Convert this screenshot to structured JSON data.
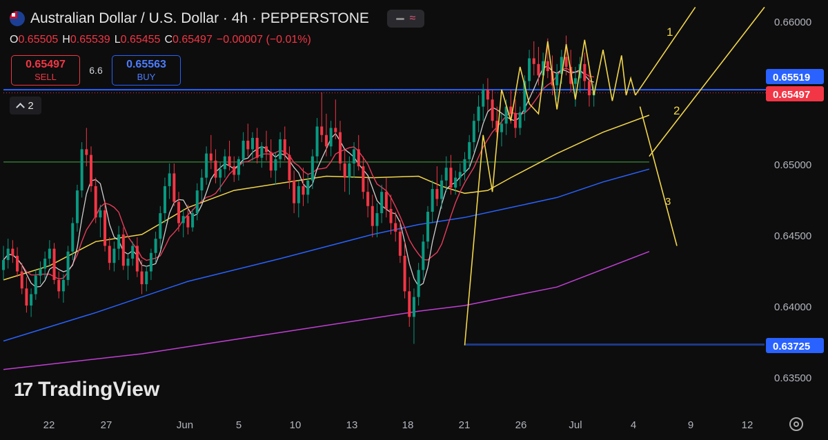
{
  "header": {
    "title": "Australian Dollar / U.S. Dollar · 4h · PEPPERSTONE",
    "flag_icon": "au-us-flag-icon"
  },
  "ohlc": {
    "o_label": "O",
    "o": "0.65505",
    "h_label": "H",
    "h": "0.65539",
    "l_label": "L",
    "l": "0.65455",
    "c_label": "C",
    "c": "0.65497",
    "change": "−0.00007 (−0.01%)"
  },
  "trade": {
    "sell_price": "0.65497",
    "sell_label": "SELL",
    "spread": "6.6",
    "buy_price": "0.65563",
    "buy_label": "BUY"
  },
  "indicators_toggle": {
    "count": "2"
  },
  "logo": {
    "text": "TradingView"
  },
  "colors": {
    "background": "#0d0d0d",
    "up_candle": "#089981",
    "down_candle": "#f23645",
    "ma_white": "#d0d0d0",
    "ma_red": "#e83c5c",
    "ma_yellow": "#f2d64b",
    "ma_blue": "#2962ff",
    "ma_purple": "#c23fd6",
    "hline_green": "#3c8a3c",
    "wave_lines": "#f2d64b",
    "support_line": "#1e3a8a"
  },
  "chart_data": {
    "type": "candlestick",
    "symbol": "AUDUSD",
    "timeframe": "4h",
    "y_axis": {
      "ticks": [
        "0.66000",
        "0.65500",
        "0.65000",
        "0.64500",
        "0.64000",
        "0.63500"
      ],
      "range": [
        0.6328,
        0.6612
      ]
    },
    "x_axis": {
      "ticks": [
        "22",
        "27",
        "Jun",
        "5",
        "10",
        "13",
        "18",
        "21",
        "26",
        "Jul",
        "4",
        "9",
        "12"
      ]
    },
    "price_labels": [
      {
        "value": "0.65519",
        "color": "#2962ff"
      },
      {
        "value": "0.65497",
        "color": "#f23645"
      },
      {
        "value": "0.63725",
        "color": "#2962ff"
      }
    ],
    "horizontal_lines": [
      {
        "price": 0.65519,
        "color": "#2962ff",
        "style": "solid"
      },
      {
        "price": 0.65497,
        "color": "#f23645",
        "style": "dotted"
      },
      {
        "price": 0.63725,
        "color": "#1e3a8a",
        "style": "solid",
        "from_t": 100
      }
    ],
    "green_line": {
      "t": [
        0,
        140
      ],
      "y": [
        0.6501,
        0.6501
      ]
    },
    "ma_series": [
      {
        "color": "#2962ff",
        "t": [
          0,
          20,
          40,
          60,
          80,
          90,
          100,
          110,
          120,
          130,
          140
        ],
        "y": [
          0.6375,
          0.6395,
          0.6417,
          0.6433,
          0.645,
          0.6457,
          0.6462,
          0.6469,
          0.6476,
          0.6487,
          0.6496
        ]
      },
      {
        "color": "#c23fd6",
        "t": [
          0,
          30,
          60,
          90,
          100,
          120,
          140
        ],
        "y": [
          0.6355,
          0.6366,
          0.6381,
          0.6396,
          0.64,
          0.6413,
          0.6438
        ]
      },
      {
        "color": "#f2d64b",
        "t": [
          0,
          10,
          20,
          30,
          40,
          50,
          60,
          70,
          80,
          90,
          95,
          100,
          105,
          110,
          120,
          130,
          140
        ],
        "y": [
          0.6418,
          0.6428,
          0.6445,
          0.645,
          0.6469,
          0.6481,
          0.6486,
          0.6491,
          0.649,
          0.6491,
          0.6484,
          0.6479,
          0.6481,
          0.649,
          0.6507,
          0.6522,
          0.6534
        ]
      }
    ],
    "candles_ohlc": [
      [
        0.6425,
        0.6442,
        0.6418,
        0.6432
      ],
      [
        0.6432,
        0.6447,
        0.6426,
        0.644
      ],
      [
        0.644,
        0.6446,
        0.643,
        0.6435
      ],
      [
        0.6435,
        0.6441,
        0.642,
        0.6424
      ],
      [
        0.6424,
        0.643,
        0.6408,
        0.6412
      ],
      [
        0.6412,
        0.642,
        0.6395,
        0.64
      ],
      [
        0.64,
        0.6412,
        0.6392,
        0.6408
      ],
      [
        0.6408,
        0.6425,
        0.6404,
        0.6421
      ],
      [
        0.6421,
        0.6431,
        0.6415,
        0.6426
      ],
      [
        0.6426,
        0.6438,
        0.6419,
        0.6433
      ],
      [
        0.6433,
        0.6446,
        0.6428,
        0.644
      ],
      [
        0.644,
        0.6444,
        0.6415,
        0.6418
      ],
      [
        0.6418,
        0.6424,
        0.6405,
        0.641
      ],
      [
        0.641,
        0.6422,
        0.6402,
        0.6418
      ],
      [
        0.6418,
        0.6442,
        0.6414,
        0.6438
      ],
      [
        0.6438,
        0.6462,
        0.6432,
        0.6458
      ],
      [
        0.6458,
        0.6485,
        0.6452,
        0.6481
      ],
      [
        0.6481,
        0.6515,
        0.6476,
        0.651
      ],
      [
        0.651,
        0.6525,
        0.6498,
        0.6506
      ],
      [
        0.6506,
        0.6512,
        0.648,
        0.6484
      ],
      [
        0.6484,
        0.649,
        0.6458,
        0.6462
      ],
      [
        0.6462,
        0.6471,
        0.6448,
        0.6467
      ],
      [
        0.6467,
        0.6474,
        0.6438,
        0.6442
      ],
      [
        0.6442,
        0.6448,
        0.6425,
        0.643
      ],
      [
        0.643,
        0.6445,
        0.6424,
        0.644
      ],
      [
        0.644,
        0.6456,
        0.6432,
        0.645
      ],
      [
        0.645,
        0.6455,
        0.6425,
        0.6428
      ],
      [
        0.6428,
        0.6437,
        0.6418,
        0.6433
      ],
      [
        0.6433,
        0.6445,
        0.6428,
        0.6442
      ],
      [
        0.6442,
        0.6448,
        0.642,
        0.6424
      ],
      [
        0.6424,
        0.6432,
        0.6408,
        0.6415
      ],
      [
        0.6415,
        0.6428,
        0.641,
        0.6424
      ],
      [
        0.6424,
        0.644,
        0.6418,
        0.6437
      ],
      [
        0.6437,
        0.6452,
        0.643,
        0.6447
      ],
      [
        0.6447,
        0.647,
        0.644,
        0.6465
      ],
      [
        0.6465,
        0.649,
        0.6458,
        0.6484
      ],
      [
        0.6484,
        0.65,
        0.6475,
        0.6493
      ],
      [
        0.6493,
        0.65,
        0.647,
        0.6473
      ],
      [
        0.6473,
        0.648,
        0.6452,
        0.6458
      ],
      [
        0.6458,
        0.6468,
        0.6448,
        0.6463
      ],
      [
        0.6463,
        0.6471,
        0.645,
        0.6455
      ],
      [
        0.6455,
        0.6468,
        0.6452,
        0.6465
      ],
      [
        0.6465,
        0.6486,
        0.646,
        0.6481
      ],
      [
        0.6481,
        0.6496,
        0.6474,
        0.649
      ],
      [
        0.649,
        0.6512,
        0.6485,
        0.6507
      ],
      [
        0.6507,
        0.652,
        0.6496,
        0.6502
      ],
      [
        0.6502,
        0.651,
        0.6486,
        0.649
      ],
      [
        0.649,
        0.6501,
        0.648,
        0.6496
      ],
      [
        0.6496,
        0.651,
        0.649,
        0.6505
      ],
      [
        0.6505,
        0.6516,
        0.6495,
        0.6498
      ],
      [
        0.6498,
        0.6505,
        0.6487,
        0.6492
      ],
      [
        0.6492,
        0.6505,
        0.6488,
        0.6503
      ],
      [
        0.6503,
        0.6522,
        0.6498,
        0.6516
      ],
      [
        0.6516,
        0.6528,
        0.6505,
        0.651
      ],
      [
        0.651,
        0.6522,
        0.6502,
        0.6518
      ],
      [
        0.6518,
        0.6525,
        0.65,
        0.6504
      ],
      [
        0.6504,
        0.6515,
        0.6497,
        0.6512
      ],
      [
        0.6512,
        0.6523,
        0.6502,
        0.6508
      ],
      [
        0.6508,
        0.6517,
        0.649,
        0.6495
      ],
      [
        0.6495,
        0.6508,
        0.6485,
        0.6503
      ],
      [
        0.6503,
        0.6522,
        0.6497,
        0.6517
      ],
      [
        0.6517,
        0.6526,
        0.6502,
        0.6506
      ],
      [
        0.6506,
        0.6512,
        0.6482,
        0.6488
      ],
      [
        0.6488,
        0.6495,
        0.6465,
        0.6472
      ],
      [
        0.6472,
        0.6488,
        0.6462,
        0.6484
      ],
      [
        0.6484,
        0.6497,
        0.647,
        0.6478
      ],
      [
        0.6478,
        0.6492,
        0.6472,
        0.6488
      ],
      [
        0.6488,
        0.651,
        0.6482,
        0.6505
      ],
      [
        0.6505,
        0.6532,
        0.65,
        0.6526
      ],
      [
        0.6526,
        0.655,
        0.6515,
        0.652
      ],
      [
        0.652,
        0.6535,
        0.6505,
        0.6512
      ],
      [
        0.6512,
        0.653,
        0.6505,
        0.6525
      ],
      [
        0.6525,
        0.6545,
        0.6517,
        0.6522
      ],
      [
        0.6522,
        0.653,
        0.6495,
        0.65
      ],
      [
        0.65,
        0.651,
        0.648,
        0.649
      ],
      [
        0.649,
        0.6505,
        0.6478,
        0.65
      ],
      [
        0.65,
        0.6515,
        0.649,
        0.651
      ],
      [
        0.651,
        0.652,
        0.6495,
        0.6498
      ],
      [
        0.6498,
        0.6505,
        0.6475,
        0.648
      ],
      [
        0.648,
        0.649,
        0.6462,
        0.647
      ],
      [
        0.647,
        0.6478,
        0.6448,
        0.6456
      ],
      [
        0.6456,
        0.6472,
        0.6448,
        0.6465
      ],
      [
        0.6465,
        0.6485,
        0.6458,
        0.648
      ],
      [
        0.648,
        0.649,
        0.6462,
        0.6468
      ],
      [
        0.6468,
        0.6478,
        0.645,
        0.6458
      ],
      [
        0.6458,
        0.6466,
        0.6445,
        0.6452
      ],
      [
        0.6452,
        0.646,
        0.643,
        0.6435
      ],
      [
        0.6435,
        0.6445,
        0.6405,
        0.641
      ],
      [
        0.641,
        0.642,
        0.6385,
        0.6392
      ],
      [
        0.6392,
        0.6412,
        0.6373,
        0.6406
      ],
      [
        0.6406,
        0.643,
        0.64,
        0.6425
      ],
      [
        0.6425,
        0.645,
        0.6418,
        0.6445
      ],
      [
        0.6445,
        0.647,
        0.644,
        0.6466
      ],
      [
        0.6466,
        0.6488,
        0.6458,
        0.6482
      ],
      [
        0.6482,
        0.6498,
        0.647,
        0.6475
      ],
      [
        0.6475,
        0.6492,
        0.6468,
        0.6488
      ],
      [
        0.6488,
        0.6505,
        0.648,
        0.6497
      ],
      [
        0.6497,
        0.6506,
        0.6478,
        0.6483
      ],
      [
        0.6483,
        0.6495,
        0.6478,
        0.649
      ],
      [
        0.649,
        0.65,
        0.6484,
        0.6494
      ],
      [
        0.6494,
        0.6508,
        0.6488,
        0.6503
      ],
      [
        0.6503,
        0.652,
        0.6496,
        0.6515
      ],
      [
        0.6515,
        0.6535,
        0.6508,
        0.653
      ],
      [
        0.653,
        0.6548,
        0.6522,
        0.654
      ],
      [
        0.654,
        0.6556,
        0.653,
        0.6552
      ],
      [
        0.6552,
        0.656,
        0.6537,
        0.6545
      ],
      [
        0.6545,
        0.6552,
        0.6525,
        0.653
      ],
      [
        0.653,
        0.654,
        0.6515,
        0.6522
      ],
      [
        0.6522,
        0.6535,
        0.6512,
        0.6528
      ],
      [
        0.6528,
        0.6545,
        0.652,
        0.654
      ],
      [
        0.654,
        0.6552,
        0.6528,
        0.6535
      ],
      [
        0.6535,
        0.6545,
        0.6518,
        0.6525
      ],
      [
        0.6525,
        0.654,
        0.652,
        0.6536
      ],
      [
        0.6536,
        0.6562,
        0.653,
        0.6558
      ],
      [
        0.6558,
        0.658,
        0.6552,
        0.6574
      ],
      [
        0.6574,
        0.6586,
        0.6562,
        0.657
      ],
      [
        0.657,
        0.6582,
        0.6555,
        0.6562
      ],
      [
        0.6562,
        0.6578,
        0.6552,
        0.6572
      ],
      [
        0.6572,
        0.6588,
        0.656,
        0.6565
      ],
      [
        0.6565,
        0.6576,
        0.6548,
        0.6555
      ],
      [
        0.6555,
        0.657,
        0.6545,
        0.6563
      ],
      [
        0.6563,
        0.658,
        0.6556,
        0.6575
      ],
      [
        0.6575,
        0.659,
        0.6562,
        0.6568
      ],
      [
        0.6568,
        0.658,
        0.655,
        0.6556
      ],
      [
        0.6556,
        0.6568,
        0.654,
        0.656
      ],
      [
        0.656,
        0.6575,
        0.655,
        0.657
      ],
      [
        0.657,
        0.6578,
        0.6552,
        0.6558
      ],
      [
        0.6558,
        0.6566,
        0.654,
        0.6548
      ],
      [
        0.6548,
        0.6556,
        0.654,
        0.655
      ]
    ],
    "wave_path": {
      "t": [
        100,
        104,
        106,
        108,
        110,
        112,
        114,
        116,
        118,
        120,
        122,
        124,
        126,
        128,
        130,
        132,
        134,
        135,
        136,
        137
      ],
      "y": [
        0.6372,
        0.652,
        0.648,
        0.6552,
        0.653,
        0.6568,
        0.6542,
        0.6535,
        0.6586,
        0.6538,
        0.6584,
        0.6545,
        0.6587,
        0.6548,
        0.658,
        0.6544,
        0.6576,
        0.6548,
        0.656,
        0.6548
      ]
    },
    "projection_lines": [
      {
        "t": [
          137,
          150
        ],
        "y": [
          0.6548,
          0.661
        ]
      },
      {
        "t": [
          138,
          146
        ],
        "y": [
          0.654,
          0.6442
        ]
      },
      {
        "t": [
          140,
          165
        ],
        "y": [
          0.6505,
          0.661
        ]
      }
    ],
    "wave_labels": [
      "1",
      "2",
      "3"
    ]
  }
}
